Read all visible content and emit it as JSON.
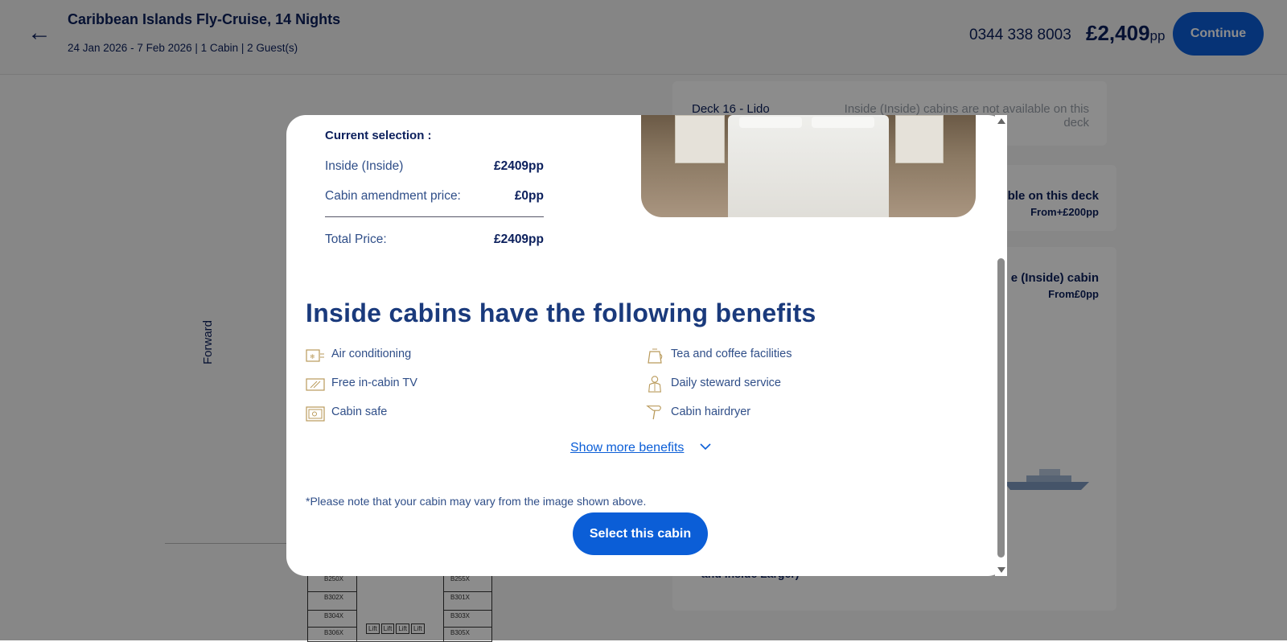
{
  "header": {
    "back_icon": "arrow-left-icon",
    "title": "Caribbean Islands Fly-Cruise, 14 Nights",
    "subtitle": "24 Jan 2026 - 7 Feb 2026  | 1 Cabin | 2 Guest(s)",
    "phone": "0344 338 8003",
    "price": "£2,409",
    "price_unit": "pp",
    "continue_label": "Continue",
    "accent": "#0b5ed7"
  },
  "background": {
    "forward_label": "Forward",
    "deck_label": "Deck 16 - Lido",
    "deck_note": "Inside (Inside) cabins are not available on this deck",
    "panel2_title": "ble on this deck",
    "panel2_price": "From+£200pp",
    "panel3_title": "e (Inside) cabin",
    "panel3_price": "From£0pp",
    "panel3_footer": "and Inside Larger)",
    "plan_cells": [
      "B250X",
      "B302X",
      "B304X",
      "B306X",
      "B255X",
      "B301X",
      "B303X",
      "B305X",
      "Lift",
      "Lift",
      "Lift",
      "Lift"
    ]
  },
  "modal": {
    "current_selection_label": "Current selection :",
    "rows": [
      {
        "label": "Inside (Inside)",
        "value": "£2409pp"
      },
      {
        "label": "Cabin amendment price:",
        "value": "£0pp"
      }
    ],
    "total_label": "Total Price:",
    "total_value": "£2409pp",
    "benefits_heading": "Inside cabins have the following benefits",
    "benefits_left": [
      {
        "icon": "air-conditioning-icon",
        "label": "Air conditioning"
      },
      {
        "icon": "tv-icon",
        "label": "Free in-cabin TV"
      },
      {
        "icon": "safe-icon",
        "label": "Cabin safe"
      }
    ],
    "benefits_right": [
      {
        "icon": "kettle-icon",
        "label": "Tea and coffee facilities"
      },
      {
        "icon": "steward-icon",
        "label": "Daily steward service"
      },
      {
        "icon": "hairdryer-icon",
        "label": "Cabin hairdryer"
      }
    ],
    "show_more_label": "Show more benefits",
    "note": "*Please note that your cabin may vary from the image shown above.",
    "select_label": "Select this cabin"
  }
}
